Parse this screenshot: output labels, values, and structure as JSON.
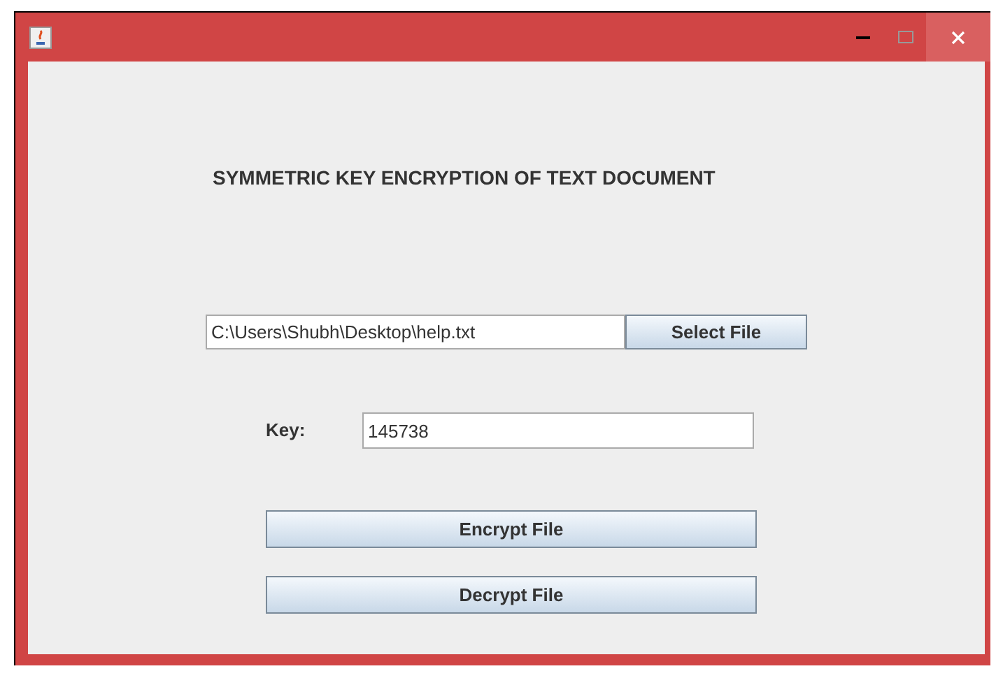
{
  "window": {
    "heading": "SYMMETRIC KEY ENCRYPTION OF TEXT DOCUMENT"
  },
  "file_field": {
    "value": "C:\\Users\\Shubh\\Desktop\\help.txt"
  },
  "select_button": "Select File",
  "key": {
    "label": "Key:",
    "value": "145738"
  },
  "buttons": [
    "Encrypt File",
    "Decrypt File"
  ]
}
